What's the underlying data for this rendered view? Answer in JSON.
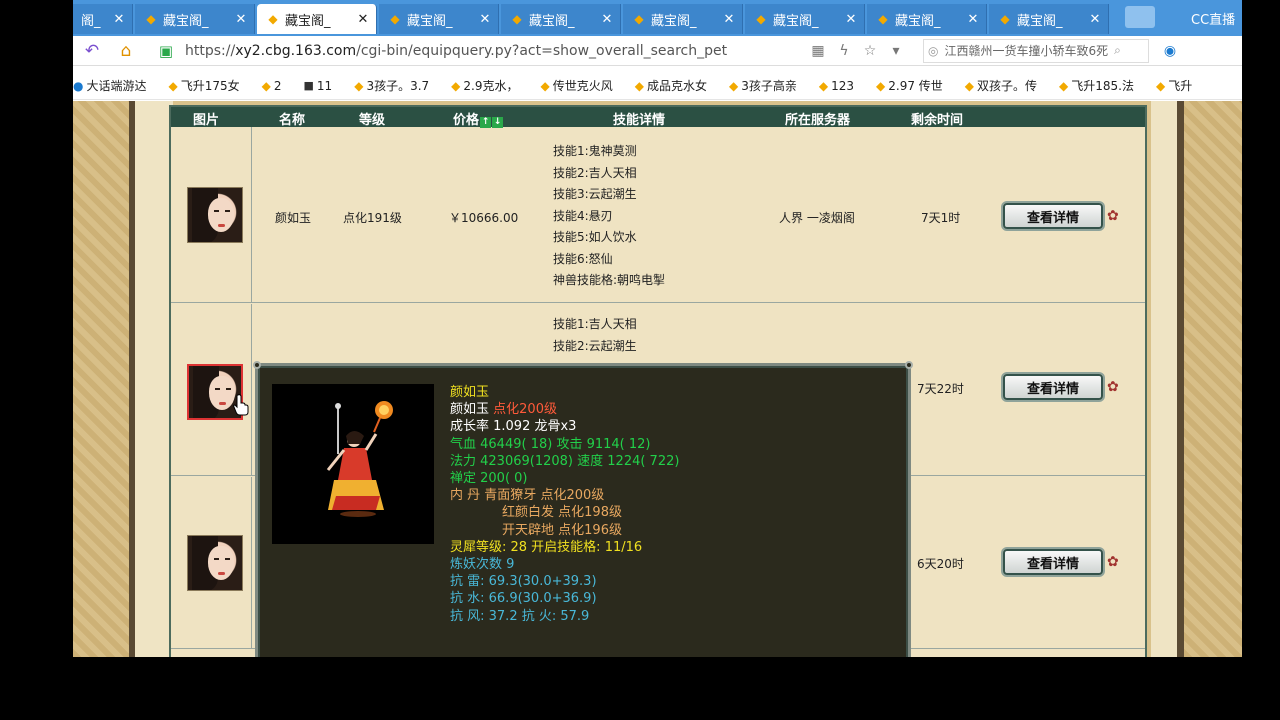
{
  "browser": {
    "tabs": [
      {
        "label": "阁_",
        "active": false
      },
      {
        "label": "藏宝阁_",
        "active": false
      },
      {
        "label": "藏宝阁_",
        "active": true
      },
      {
        "label": "藏宝阁_",
        "active": false
      },
      {
        "label": "藏宝阁_",
        "active": false
      },
      {
        "label": "藏宝阁_",
        "active": false
      },
      {
        "label": "藏宝阁_",
        "active": false
      },
      {
        "label": "藏宝阁_",
        "active": false
      },
      {
        "label": "藏宝阁_",
        "active": false
      }
    ],
    "cc_badge": "CC直播",
    "url_scheme": "https://",
    "url_host": "xy2.cbg.163.com",
    "url_path": "/cgi-bin/equipquery.py?act=show_overall_search_pet",
    "search_text": "江西赣州一货车撞小轿车致6死",
    "bookmarks": [
      "大话端游达",
      "飞升175女",
      "2",
      "11",
      "3孩子。3.7",
      "2.9克水，",
      "传世克火风",
      "成品克水女",
      "3孩子高亲",
      "123",
      "2.97 传世",
      "双孩子。传",
      "飞升185.法",
      "飞升"
    ]
  },
  "table": {
    "headers": {
      "image": "图片",
      "name": "名称",
      "level": "等级",
      "price": "价格",
      "price_up": "↑",
      "price_down": "↓",
      "skills": "技能详情",
      "server": "所在服务器",
      "time_left": "剩余时间"
    },
    "detail_label": "查看详情",
    "rows": [
      {
        "name": "颜如玉",
        "level": "点化191级",
        "price": "￥10666.00",
        "skills": [
          "技能1:鬼神莫测",
          "技能2:吉人天相",
          "技能3:云起潮生",
          "技能4:悬刃",
          "技能5:如人饮水",
          "技能6:怒仙",
          "神兽技能格:朝鸣电掣"
        ],
        "server": "人界 一凌烟阁",
        "time_left": "7天1时"
      },
      {
        "skills": [
          "技能1:吉人天相",
          "技能2:云起潮生"
        ],
        "time_left": "7天22时"
      },
      {
        "time_left": "6天20时"
      }
    ]
  },
  "popup": {
    "title": "颜如玉",
    "name": "颜如玉",
    "level": "点化200级",
    "growth": "成长率 1.092 龙骨x3",
    "hp": "气血 46449( 18)",
    "attack": "攻击 9114( 12)",
    "mana": "法力 423069(1208)",
    "speed": "速度 1224( 722)",
    "calm": "禅定 200( 0)",
    "neidan_label": "内  丹",
    "neidan": [
      {
        "name": "青面獠牙",
        "level": "点化200级"
      },
      {
        "name": "红颜白发",
        "level": "点化198级"
      },
      {
        "name": "开天辟地",
        "level": "点化196级"
      }
    ],
    "lingxi": "灵犀等级: 28 开启技能格: 11/16",
    "lianyao": "炼妖次数 9",
    "resist_thunder": "抗  雷: 69.3(30.0+39.3)",
    "resist_water": "抗  水: 66.9(30.0+36.9)",
    "resist_wind": "抗  风: 37.2",
    "resist_fire": "抗  火: 57.9"
  },
  "colors": {
    "tabbar": "#4a96dc",
    "header": "#2b5043",
    "popup_bg": "#2b2a1d"
  }
}
